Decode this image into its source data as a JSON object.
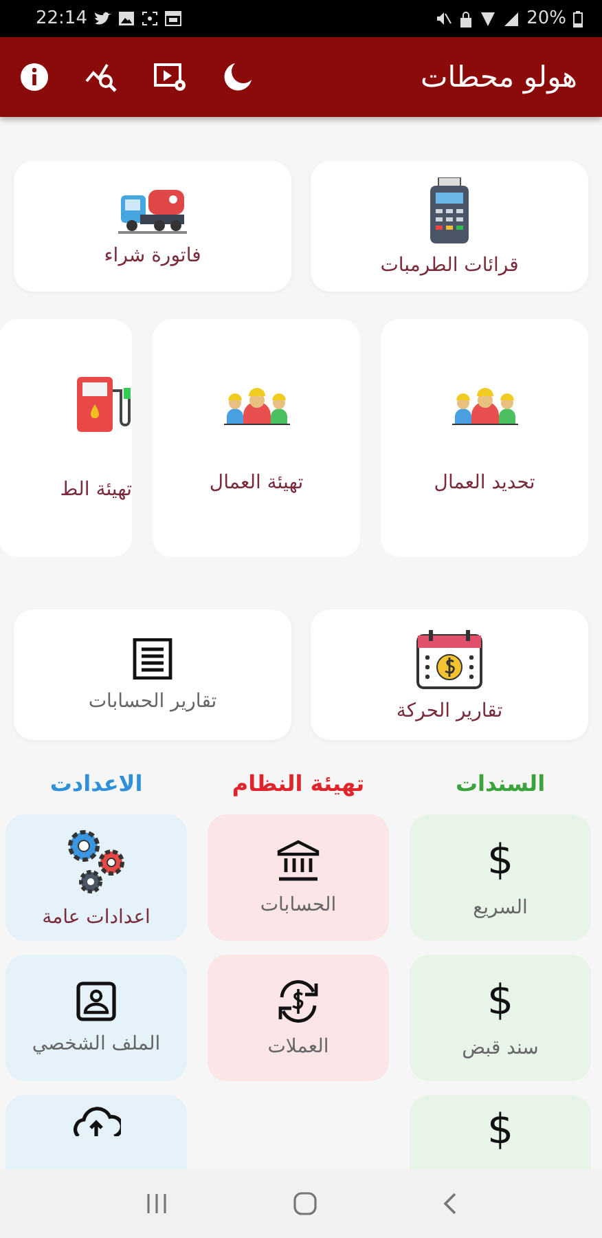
{
  "status_bar": {
    "time": "22:14",
    "battery": "20%"
  },
  "app_bar": {
    "title": "هولو محطات"
  },
  "top_tiles": [
    {
      "label": "قرائات الطرمبات"
    },
    {
      "label": "فاتورة شراء"
    }
  ],
  "worker_tiles": [
    {
      "label": "تحديد العمال"
    },
    {
      "label": "تهيئة العمال"
    },
    {
      "label": "تهيئة الط"
    }
  ],
  "report_tiles": [
    {
      "label": "تقارير الحركة"
    },
    {
      "label": "تقارير الحسابات"
    }
  ],
  "sections": [
    {
      "title": "السندات",
      "color": "#3aa33a",
      "items": [
        {
          "kind": "symbol",
          "symbol": "$",
          "label": "السريع"
        },
        {
          "kind": "symbol",
          "symbol": "$",
          "label": "سند قبض"
        },
        {
          "kind": "symbol",
          "symbol": "$"
        }
      ]
    },
    {
      "title": "تهيئة النظام",
      "color": "#e0242b",
      "items": [
        {
          "kind": "icon",
          "label": "الحسابات"
        },
        {
          "kind": "icon",
          "label": "العملات"
        }
      ]
    },
    {
      "title": "الاعدادت",
      "color": "#2f8fd8",
      "items": [
        {
          "kind": "icon",
          "label": "اعدادات عامة"
        },
        {
          "kind": "icon",
          "label": "الملف الشخصي"
        },
        {
          "kind": "icon"
        }
      ]
    }
  ]
}
